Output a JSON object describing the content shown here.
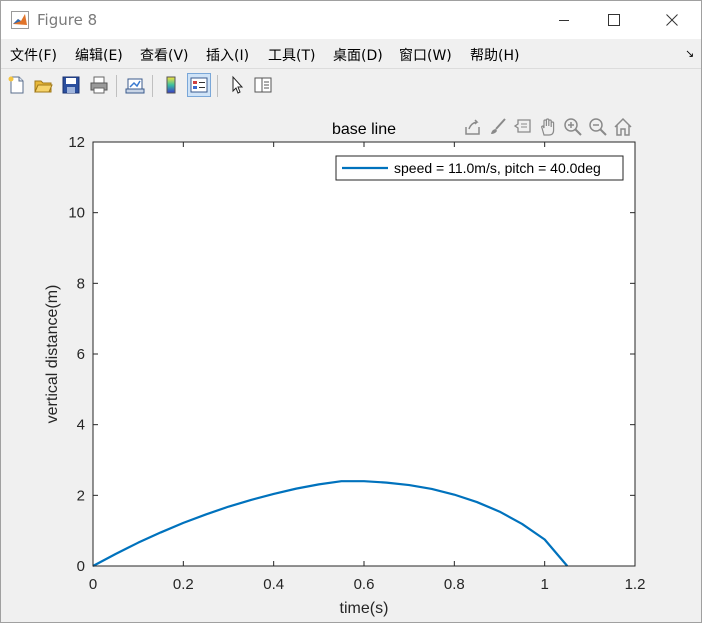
{
  "window": {
    "title": "Figure 8"
  },
  "menubar": {
    "items": [
      {
        "label": "文件(F)",
        "name": "menu-file"
      },
      {
        "label": "编辑(E)",
        "name": "menu-edit"
      },
      {
        "label": "查看(V)",
        "name": "menu-view"
      },
      {
        "label": "插入(I)",
        "name": "menu-insert"
      },
      {
        "label": "工具(T)",
        "name": "menu-tools"
      },
      {
        "label": "桌面(D)",
        "name": "menu-desktop"
      },
      {
        "label": "窗口(W)",
        "name": "menu-window"
      },
      {
        "label": "帮助(H)",
        "name": "menu-help"
      }
    ],
    "dock_icon": "dock-arrow-icon"
  },
  "toolbar": {
    "buttons": [
      {
        "icon": "new-figure-icon"
      },
      {
        "icon": "open-file-icon"
      },
      {
        "icon": "save-icon"
      },
      {
        "icon": "print-icon"
      },
      {
        "icon": "link-plot-icon"
      },
      {
        "icon": "insert-colorbar-icon"
      },
      {
        "icon": "insert-legend-icon"
      },
      {
        "icon": "edit-plot-arrow-icon"
      },
      {
        "icon": "property-inspector-icon"
      }
    ]
  },
  "axes_toolbar": {
    "icons": [
      "export-icon",
      "brush-icon",
      "data-tips-icon",
      "pan-hand-icon",
      "zoom-in-icon",
      "zoom-out-icon",
      "home-icon"
    ]
  },
  "colors": {
    "line": "#0072bd",
    "axes_bg": "#ffffff",
    "figure_bg": "#f0f0f0"
  },
  "chart_data": {
    "type": "line",
    "title": "base line",
    "xlabel": "time(s)",
    "ylabel": "vertical distance(m)",
    "xlim": [
      0,
      1.2
    ],
    "ylim": [
      0,
      12
    ],
    "xticks": [
      0,
      0.2,
      0.4,
      0.6,
      0.8,
      1,
      1.2
    ],
    "xtick_labels": [
      "0",
      "0.2",
      "0.4",
      "0.6",
      "0.8",
      "1",
      "1.2"
    ],
    "yticks": [
      0,
      2,
      4,
      6,
      8,
      10,
      12
    ],
    "ytick_labels": [
      "0",
      "2",
      "4",
      "6",
      "8",
      "10",
      "12"
    ],
    "grid": false,
    "legend_position": "top-right",
    "series": [
      {
        "name": "speed = 11.0m/s, pitch = 40.0deg",
        "x": [
          0,
          0.05,
          0.1,
          0.15,
          0.2,
          0.25,
          0.3,
          0.35,
          0.4,
          0.45,
          0.5,
          0.55,
          0.6,
          0.65,
          0.7,
          0.75,
          0.8,
          0.85,
          0.9,
          0.95,
          1.0,
          1.05
        ],
        "y": [
          0,
          0.34,
          0.66,
          0.95,
          1.22,
          1.46,
          1.68,
          1.87,
          2.04,
          2.19,
          2.31,
          2.4,
          2.4,
          2.36,
          2.29,
          2.18,
          2.02,
          1.81,
          1.54,
          1.19,
          0.75,
          0.0
        ]
      }
    ]
  }
}
